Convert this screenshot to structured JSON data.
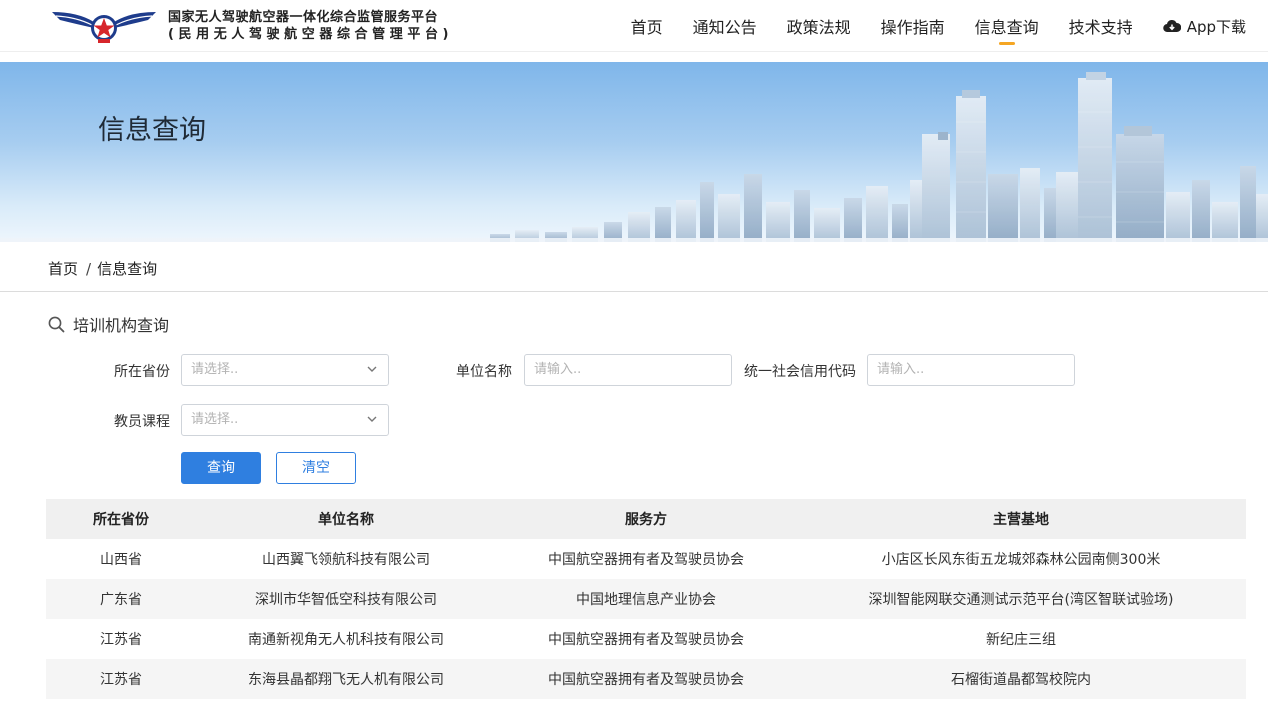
{
  "brand": {
    "title_line1": "国家无人驾驶航空器一体化综合监管服务平台",
    "title_line2": "(民用无人驾驶航空器综合管理平台)"
  },
  "nav": {
    "items": [
      "首页",
      "通知公告",
      "政策法规",
      "操作指南",
      "信息查询",
      "技术支持"
    ],
    "active": "信息查询",
    "app_label": "App下载",
    "accent": "#f5a623"
  },
  "banner": {
    "title": "信息查询"
  },
  "breadcrumb": {
    "home": "首页",
    "separator": "/",
    "current": "信息查询"
  },
  "section": {
    "title": "培训机构查询",
    "icon": "search-icon"
  },
  "form": {
    "province_label": "所在省份",
    "province_placeholder": "请选择..",
    "unit_label": "单位名称",
    "unit_placeholder": "请输入..",
    "credit_label": "统一社会信用代码",
    "credit_placeholder": "请输入..",
    "course_label": "教员课程",
    "course_placeholder": "请选择..",
    "query_button": "查询",
    "clear_button": "清空",
    "primary_color": "#2f7fe0"
  },
  "table": {
    "headers": [
      "所在省份",
      "单位名称",
      "服务方",
      "主营基地"
    ],
    "rows": [
      [
        "山西省",
        "山西翼飞领航科技有限公司",
        "中国航空器拥有者及驾驶员协会",
        "小店区长风东街五龙城郊森林公园南侧300米"
      ],
      [
        "广东省",
        "深圳市华智低空科技有限公司",
        "中国地理信息产业协会",
        "深圳智能网联交通测试示范平台(湾区智联试验场)"
      ],
      [
        "江苏省",
        "南通新视角无人机科技有限公司",
        "中国航空器拥有者及驾驶员协会",
        "新纪庄三组"
      ],
      [
        "江苏省",
        "东海县晶都翔飞无人机有限公司",
        "中国航空器拥有者及驾驶员协会",
        "石榴街道晶都驾校院内"
      ]
    ]
  }
}
